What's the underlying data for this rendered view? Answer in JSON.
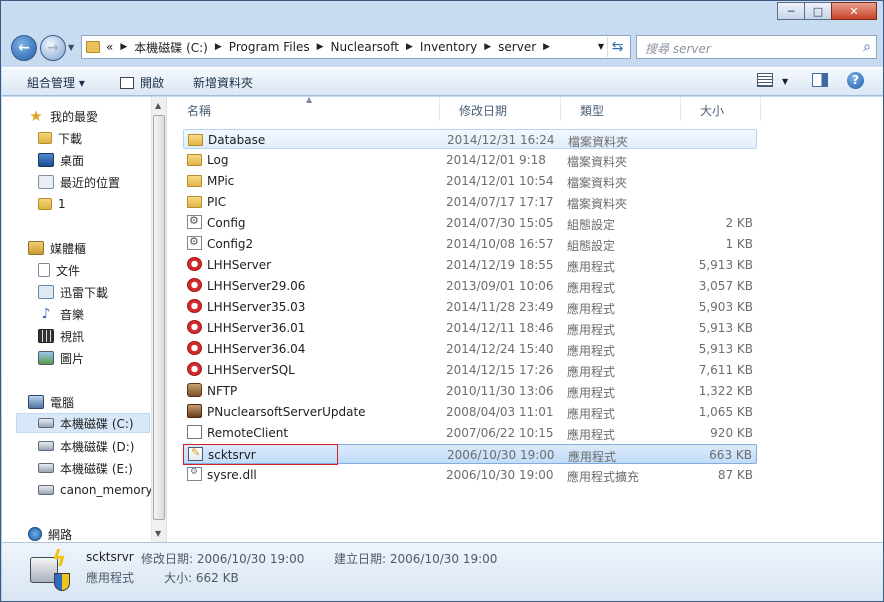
{
  "window": {
    "caption": {
      "minimize": "─",
      "maximize": "□",
      "close": "✕"
    }
  },
  "address": {
    "overflow": "«",
    "crumbs": [
      "本機磁碟 (C:)",
      "Program Files",
      "Nuclearsoft",
      "Inventory",
      "server"
    ],
    "search_placeholder": "搜尋 server"
  },
  "toolbar": {
    "organize": "組合管理 ▾",
    "open": "開啟",
    "new_folder": "新增資料夾",
    "help": "?"
  },
  "nav": {
    "favorites": {
      "label": "我的最愛",
      "items": [
        "下載",
        "桌面",
        "最近的位置",
        "1"
      ]
    },
    "libraries": {
      "label": "媒體櫃",
      "items": [
        "文件",
        "迅雷下載",
        "音樂",
        "視訊",
        "圖片"
      ]
    },
    "computer": {
      "label": "電腦",
      "items": [
        "本機磁碟 (C:)",
        "本機磁碟 (D:)",
        "本機磁碟 (E:)",
        "canon_memory"
      ]
    },
    "network": {
      "label": "網路"
    }
  },
  "columns": {
    "name": "名稱",
    "date": "修改日期",
    "type": "類型",
    "size": "大小"
  },
  "files": [
    {
      "name": "Database",
      "date": "2014/12/31 16:24",
      "type": "檔案資料夾",
      "size": "",
      "icon": "folder-icon"
    },
    {
      "name": "Log",
      "date": "2014/12/01 9:18",
      "type": "檔案資料夾",
      "size": "",
      "icon": "folder-icon"
    },
    {
      "name": "MPic",
      "date": "2014/12/01 10:54",
      "type": "檔案資料夾",
      "size": "",
      "icon": "folder-icon"
    },
    {
      "name": "PIC",
      "date": "2014/07/17 17:17",
      "type": "檔案資料夾",
      "size": "",
      "icon": "folder-icon"
    },
    {
      "name": "Config",
      "date": "2014/07/30 15:05",
      "type": "組態設定",
      "size": "2 KB",
      "icon": "config-file-icon"
    },
    {
      "name": "Config2",
      "date": "2014/10/08 16:57",
      "type": "組態設定",
      "size": "1 KB",
      "icon": "config-file-icon"
    },
    {
      "name": "LHHServer",
      "date": "2014/12/19 18:55",
      "type": "應用程式",
      "size": "5,913 KB",
      "icon": "app-red-logo-icon"
    },
    {
      "name": "LHHServer29.06",
      "date": "2013/09/01 10:06",
      "type": "應用程式",
      "size": "3,057 KB",
      "icon": "app-red-logo-icon"
    },
    {
      "name": "LHHServer35.03",
      "date": "2014/11/28 23:49",
      "type": "應用程式",
      "size": "5,903 KB",
      "icon": "app-red-logo-icon"
    },
    {
      "name": "LHHServer36.01",
      "date": "2014/12/11 18:46",
      "type": "應用程式",
      "size": "5,913 KB",
      "icon": "app-red-logo-icon"
    },
    {
      "name": "LHHServer36.04",
      "date": "2014/12/24 15:40",
      "type": "應用程式",
      "size": "5,913 KB",
      "icon": "app-red-logo-icon"
    },
    {
      "name": "LHHServerSQL",
      "date": "2014/12/15 17:26",
      "type": "應用程式",
      "size": "7,611 KB",
      "icon": "app-red-logo-icon"
    },
    {
      "name": "NFTP",
      "date": "2010/11/30 13:06",
      "type": "應用程式",
      "size": "1,322 KB",
      "icon": "nftp-app-icon"
    },
    {
      "name": "PNuclearsoftServerUpdate",
      "date": "2008/04/03 11:01",
      "type": "應用程式",
      "size": "1,065 KB",
      "icon": "update-app-icon"
    },
    {
      "name": "RemoteClient",
      "date": "2007/06/22 10:15",
      "type": "應用程式",
      "size": "920 KB",
      "icon": "remote-client-icon"
    },
    {
      "name": "scktsrvr",
      "date": "2006/10/30 19:00",
      "type": "應用程式",
      "size": "663 KB",
      "icon": "socket-server-icon"
    },
    {
      "name": "sysre.dll",
      "date": "2006/10/30 19:00",
      "type": "應用程式擴充",
      "size": "87 KB",
      "icon": "dll-file-icon"
    }
  ],
  "details": {
    "name": "scktsrvr",
    "type": "應用程式",
    "modified": "修改日期: 2006/10/30 19:00",
    "created": "建立日期: 2006/10/30 19:00",
    "size": "大小: 662 KB"
  }
}
